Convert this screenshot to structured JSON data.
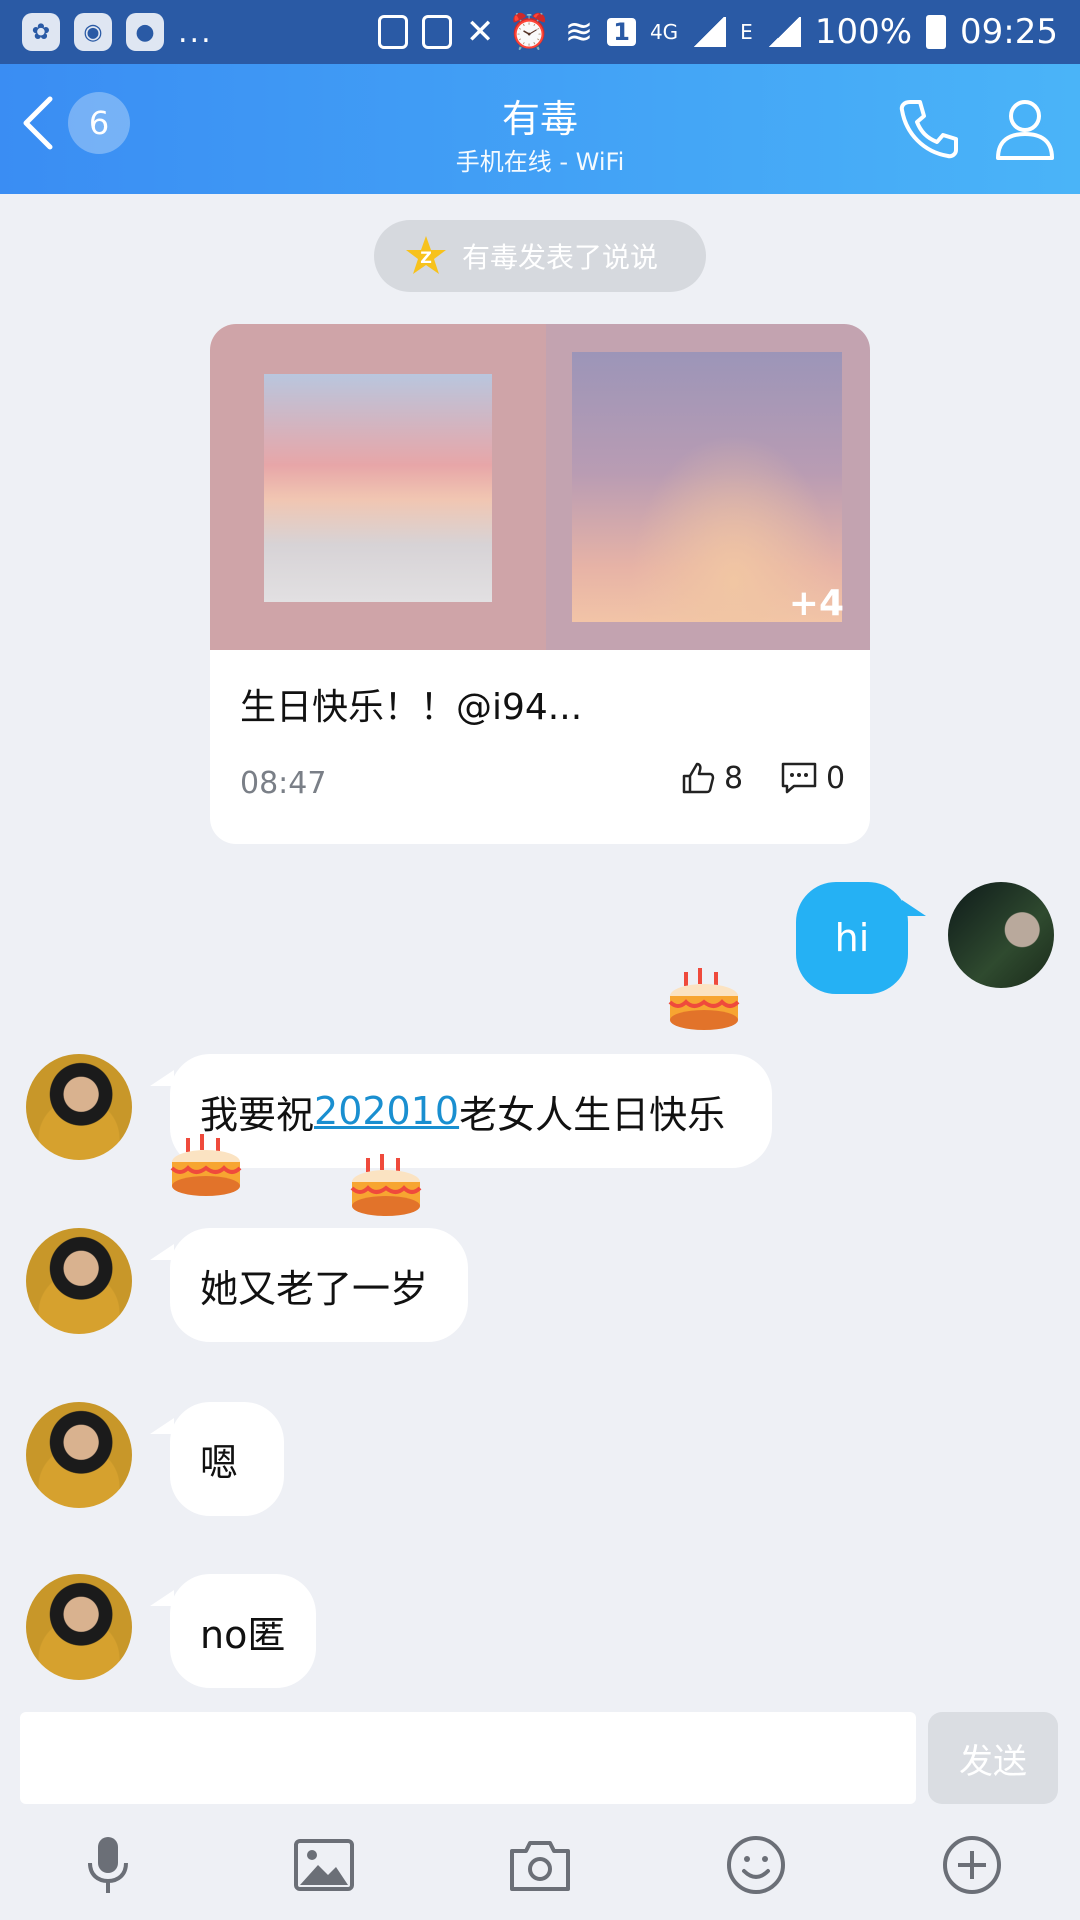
{
  "status_bar": {
    "battery": "100%",
    "time": "09:25",
    "sim_badge": "1",
    "network": "4G",
    "network2": "E"
  },
  "header": {
    "back_count": "6",
    "title": "有毒",
    "subtitle": "手机在线 - WiFi"
  },
  "notice": {
    "text": "有毒发表了说说"
  },
  "post_card": {
    "more_images": "+4",
    "text": "生日快乐！！@i94...",
    "time": "08:47",
    "likes": "8",
    "comments": "0"
  },
  "messages": [
    {
      "sender": "self",
      "text": "hi"
    },
    {
      "sender": "other",
      "text_before": "我要祝",
      "link": "202010",
      "text_after": "老女人生日快乐"
    },
    {
      "sender": "other",
      "text": "她又老了一岁"
    },
    {
      "sender": "other",
      "text": "嗯"
    },
    {
      "sender": "other",
      "text": "no匿"
    }
  ],
  "input": {
    "placeholder": "",
    "send_label": "发送"
  },
  "colors": {
    "header_start": "#3a8df3",
    "header_end": "#4ab4f8",
    "outgoing_bubble": "#25b1f4",
    "background": "#eef0f5"
  }
}
